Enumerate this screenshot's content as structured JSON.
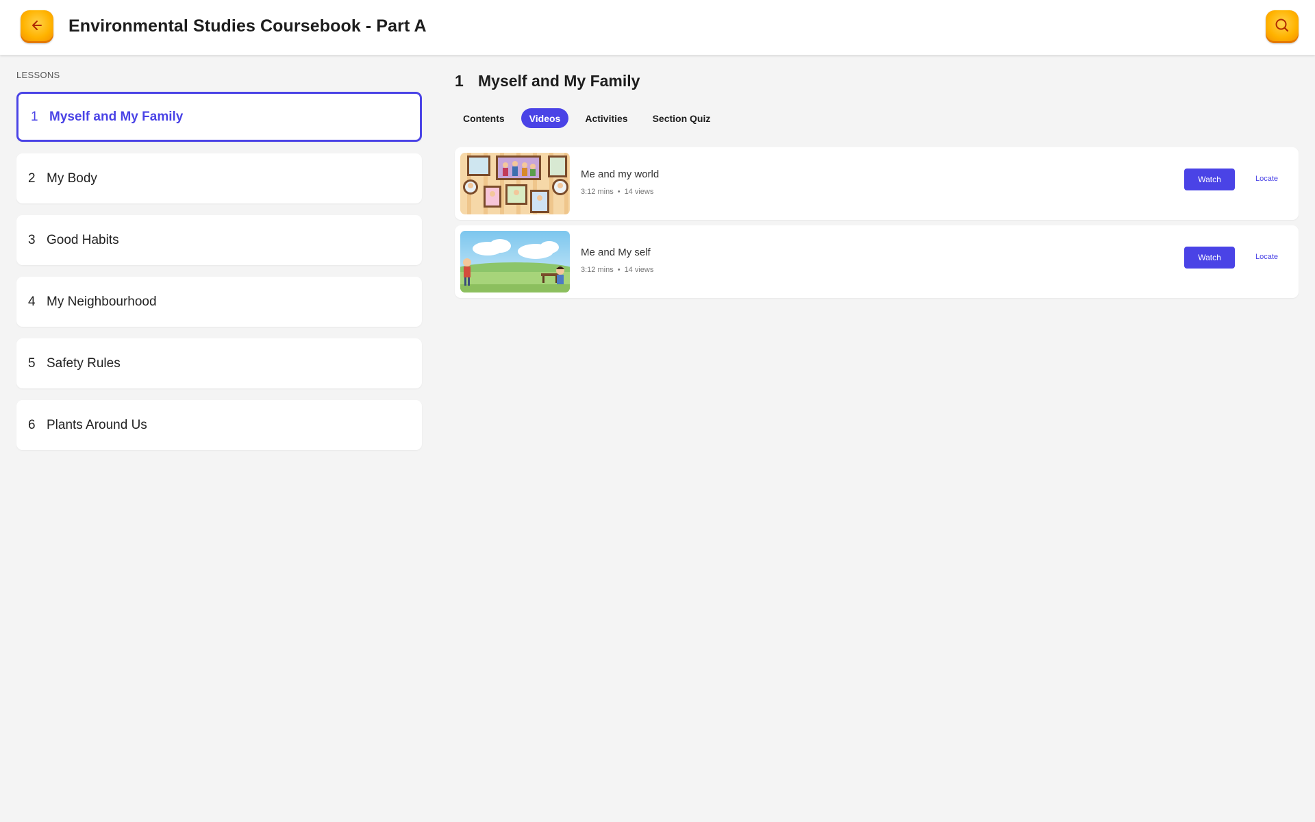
{
  "header": {
    "title": "Environmental Studies Coursebook - Part A",
    "back_icon": "back-arrow-icon",
    "search_icon": "search-icon",
    "accent_color": "#ffb300"
  },
  "sidebar": {
    "label": "LESSONS",
    "items": [
      {
        "num": "1",
        "label": "Myself and My Family",
        "active": true
      },
      {
        "num": "2",
        "label": "My Body"
      },
      {
        "num": "3",
        "label": "Good Habits"
      },
      {
        "num": "4",
        "label": "My Neighbourhood"
      },
      {
        "num": "5",
        "label": "Safety Rules"
      },
      {
        "num": "6",
        "label": "Plants Around Us"
      }
    ]
  },
  "main": {
    "section_num": "1",
    "section_title": "Myself and My Family",
    "tabs": [
      {
        "label": "Contents"
      },
      {
        "label": "Videos",
        "active": true
      },
      {
        "label": "Activities"
      },
      {
        "label": "Section Quiz"
      }
    ],
    "videos": [
      {
        "title": "Me and my world",
        "duration": "3:12 mins",
        "views": "14 views",
        "watch_label": "Watch",
        "locate_label": "Locate",
        "thumbnail": "family-photos-thumbnail"
      },
      {
        "title": "Me and My self",
        "duration": "3:12 mins",
        "views": "14 views",
        "watch_label": "Watch",
        "locate_label": "Locate",
        "thumbnail": "park-scene-thumbnail"
      }
    ]
  },
  "colors": {
    "accent": "#4a43e6",
    "button_orange": "#ffb300",
    "background": "#f4f4f4"
  }
}
